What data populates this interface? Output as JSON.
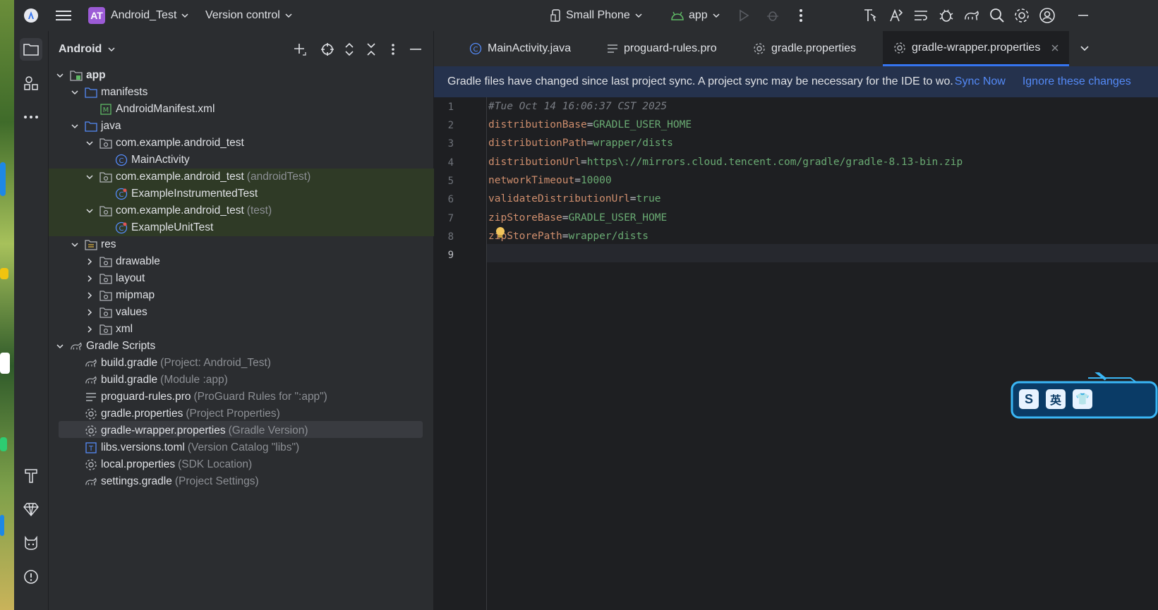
{
  "titlebar": {
    "project_badge": "AT",
    "project_name": "Android_Test",
    "version_control": "Version control",
    "device": "Small Phone",
    "run_config": "app"
  },
  "activity_bar": {
    "icons": [
      "project-folder-icon",
      "structure-icon",
      "more-icon",
      "build-hammer-icon",
      "gem-icon",
      "logcat-cat-icon",
      "problems-icon"
    ]
  },
  "project_panel": {
    "view_selector": "Android",
    "tree": [
      {
        "label": "app",
        "hint": ""
      },
      {
        "label": "manifests",
        "hint": ""
      },
      {
        "label": "AndroidManifest.xml",
        "hint": ""
      },
      {
        "label": "java",
        "hint": ""
      },
      {
        "label": "com.example.android_test",
        "hint": ""
      },
      {
        "label": "MainActivity",
        "hint": ""
      },
      {
        "label": "com.example.android_test",
        "hint": "(androidTest)"
      },
      {
        "label": "ExampleInstrumentedTest",
        "hint": ""
      },
      {
        "label": "com.example.android_test",
        "hint": "(test)"
      },
      {
        "label": "ExampleUnitTest",
        "hint": ""
      },
      {
        "label": "res",
        "hint": ""
      },
      {
        "label": "drawable",
        "hint": ""
      },
      {
        "label": "layout",
        "hint": ""
      },
      {
        "label": "mipmap",
        "hint": ""
      },
      {
        "label": "values",
        "hint": ""
      },
      {
        "label": "xml",
        "hint": ""
      },
      {
        "label": "Gradle Scripts",
        "hint": ""
      },
      {
        "label": "build.gradle",
        "hint": "(Project: Android_Test)"
      },
      {
        "label": "build.gradle",
        "hint": "(Module :app)"
      },
      {
        "label": "proguard-rules.pro",
        "hint": "(ProGuard Rules for \":app\")"
      },
      {
        "label": "gradle.properties",
        "hint": "(Project Properties)"
      },
      {
        "label": "gradle-wrapper.properties",
        "hint": "(Gradle Version)"
      },
      {
        "label": "libs.versions.toml",
        "hint": "(Version Catalog \"libs\")"
      },
      {
        "label": "local.properties",
        "hint": "(SDK Location)"
      },
      {
        "label": "settings.gradle",
        "hint": "(Project Settings)"
      }
    ]
  },
  "editor": {
    "tabs": [
      {
        "label": "MainActivity.java"
      },
      {
        "label": "proguard-rules.pro"
      },
      {
        "label": "gradle.properties"
      },
      {
        "label": "gradle-wrapper.properties"
      }
    ],
    "banner": {
      "message": "Gradle files have changed since last project sync. A project sync may be necessary for the IDE to wo.",
      "sync_now": "Sync Now",
      "ignore": "Ignore these changes"
    },
    "line_numbers": [
      "1",
      "2",
      "3",
      "4",
      "5",
      "6",
      "7",
      "8",
      "9"
    ],
    "lines": [
      {
        "comment": "#Tue Oct 14 16:06:37 CST 2025"
      },
      {
        "key": "distributionBase",
        "eq": "=",
        "value": "GRADLE_USER_HOME"
      },
      {
        "key": "distributionPath",
        "eq": "=",
        "value": "wrapper/dists"
      },
      {
        "key": "distributionUrl",
        "eq": "=",
        "value": "https\\://mirrors.cloud.tencent.com/gradle/gradle-8.13-bin.zip"
      },
      {
        "key": "networkTimeout",
        "eq": "=",
        "value": "10000"
      },
      {
        "key": "validateDistributionUrl",
        "eq": "=",
        "value": "true"
      },
      {
        "key": "zipStoreBase",
        "eq": "=",
        "value": "GRADLE_USER_HOME"
      },
      {
        "key": "zipStorePath",
        "eq": "=",
        "value": "wrapper/dists"
      }
    ]
  },
  "widget": {
    "buttons": [
      "S",
      "英",
      "👕"
    ]
  }
}
